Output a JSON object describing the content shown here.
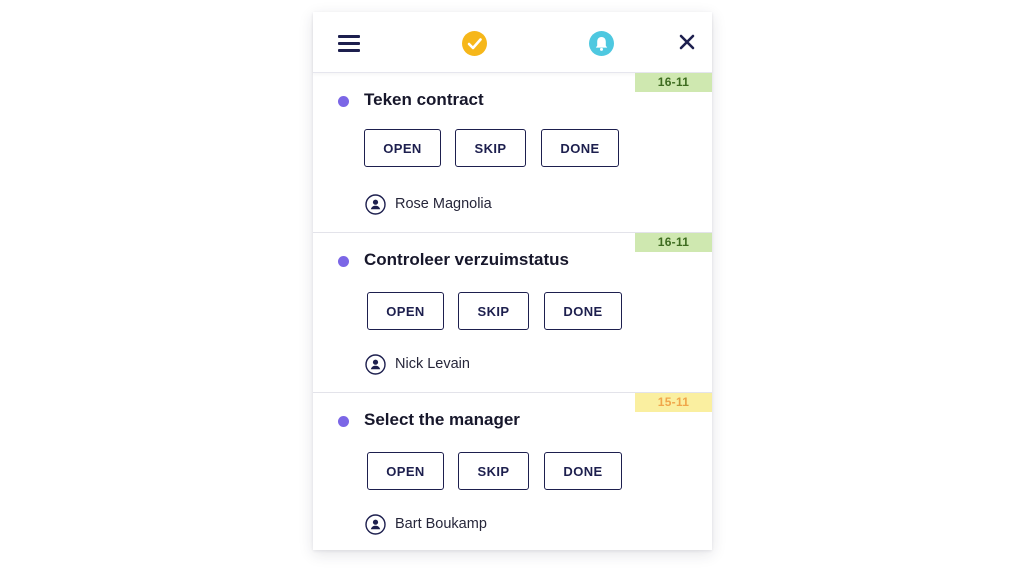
{
  "header": {
    "menu_icon": "hamburger-menu-icon",
    "status_icon": "check-circle-icon",
    "notification_icon": "bell-icon",
    "close_icon": "close-icon"
  },
  "colors": {
    "navy": "#1d1f4e",
    "dot": "#7b66e6",
    "check_bg": "#f6b71a",
    "bell_bg": "#4ec8e0",
    "badge_green_bg": "#cfe8b0",
    "badge_green_text": "#3d6b1f",
    "badge_yellow_bg": "#faefa0",
    "badge_yellow_text": "#f0a64a"
  },
  "tasks": [
    {
      "title": "Teken contract",
      "date": "16-11",
      "date_status": "green",
      "actions": {
        "open": "OPEN",
        "skip": "SKIP",
        "done": "DONE"
      },
      "assignee": "Rose Magnolia"
    },
    {
      "title": "Controleer verzuimstatus",
      "date": "16-11",
      "date_status": "green",
      "actions": {
        "open": "OPEN",
        "skip": "SKIP",
        "done": "DONE"
      },
      "assignee": "Nick Levain"
    },
    {
      "title": "Select the manager",
      "date": "15-11",
      "date_status": "yellow",
      "actions": {
        "open": "OPEN",
        "skip": "SKIP",
        "done": "DONE"
      },
      "assignee": "Bart Boukamp"
    }
  ]
}
